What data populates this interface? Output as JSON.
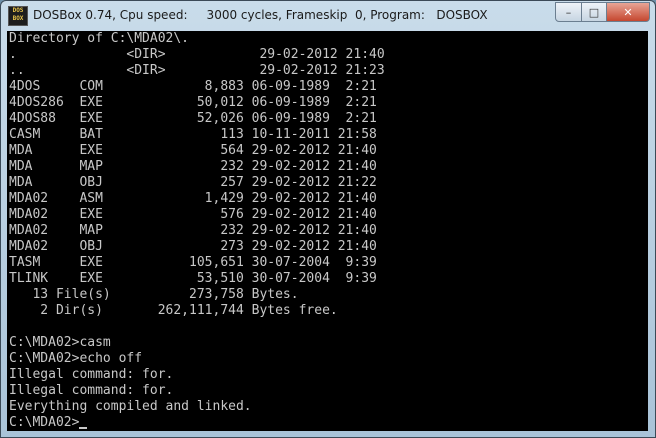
{
  "window": {
    "title": "DOSBox 0.74, Cpu speed:     3000 cycles, Frameskip  0, Program:   DOSBOX",
    "icon_text": [
      "DOS",
      "BOX"
    ],
    "buttons": {
      "minimize": "–",
      "maximize": "□",
      "close": "✕"
    }
  },
  "console": {
    "lines": [
      "Directory of C:\\MDA02\\.",
      ".              <DIR>            29-02-2012 21:40",
      "..             <DIR>            29-02-2012 21:23",
      "4DOS     COM             8,883 06-09-1989  2:21",
      "4DOS286  EXE            50,012 06-09-1989  2:21",
      "4DOS88   EXE            52,026 06-09-1989  2:21",
      "CASM     BAT               113 10-11-2011 21:58",
      "MDA      EXE               564 29-02-2012 21:40",
      "MDA      MAP               232 29-02-2012 21:40",
      "MDA      OBJ               257 29-02-2012 21:22",
      "MDA02    ASM             1,429 29-02-2012 21:40",
      "MDA02    EXE               576 29-02-2012 21:40",
      "MDA02    MAP               232 29-02-2012 21:40",
      "MDA02    OBJ               273 29-02-2012 21:40",
      "TASM     EXE           105,651 30-07-2004  9:39",
      "TLINK    EXE            53,510 30-07-2004  9:39",
      "   13 File(s)          273,758 Bytes.",
      "    2 Dir(s)       262,111,744 Bytes free.",
      "",
      "C:\\MDA02>casm",
      "C:\\MDA02>echo off",
      "Illegal command: for.",
      "Illegal command: for.",
      "Everything compiled and linked.",
      "C:\\MDA02>"
    ]
  },
  "colors": {
    "console_bg": "#000000",
    "console_fg": "#c8c8c8"
  }
}
